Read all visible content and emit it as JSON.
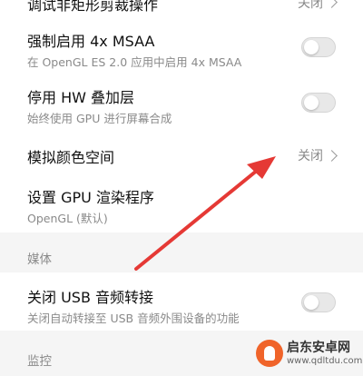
{
  "settings": {
    "item_0": {
      "title": "调试非矩形剪裁操作",
      "value": "关闭"
    },
    "item_1": {
      "title": "强制启用 4x MSAA",
      "subtitle": "在 OpenGL ES 2.0 应用中启用 4x MSAA",
      "toggle_on": false
    },
    "item_2": {
      "title": "停用 HW 叠加层",
      "subtitle": "始终使用 GPU 进行屏幕合成",
      "toggle_on": false
    },
    "item_3": {
      "title": "模拟颜色空间",
      "value": "关闭"
    },
    "item_4": {
      "title": "设置 GPU 渲染程序",
      "subtitle": "OpenGL (默认)"
    }
  },
  "sections": {
    "media": {
      "label": "媒体"
    },
    "monitor": {
      "label": "监控"
    }
  },
  "media_items": {
    "item_0": {
      "title": "关闭 USB 音频转接",
      "subtitle": "关闭自动转接至 USB 音频外围设备的功能",
      "toggle_on": false
    }
  },
  "annotation": {
    "arrow_color": "#e53935"
  },
  "watermark": {
    "name": "启东安卓网",
    "url": "www.qdltdu.com"
  }
}
